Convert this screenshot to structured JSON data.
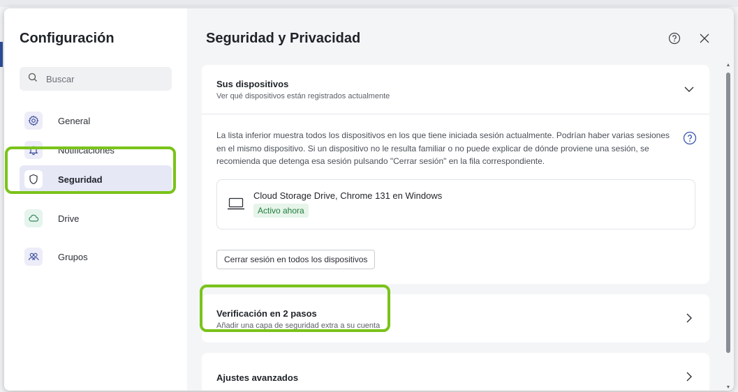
{
  "sidebar": {
    "title": "Configuración",
    "search_placeholder": "Buscar",
    "items": [
      {
        "label": "General",
        "icon": "gear-icon"
      },
      {
        "label": "Notificaciones",
        "icon": "bell-icon"
      },
      {
        "label": "Seguridad",
        "icon": "shield-icon",
        "active": true
      },
      {
        "label": "Drive",
        "icon": "cloud-icon"
      },
      {
        "label": "Grupos",
        "icon": "group-icon"
      }
    ]
  },
  "main": {
    "title": "Seguridad y Privacidad",
    "devices": {
      "title": "Sus dispositivos",
      "subtitle": "Ver qué dispositivos están registrados actualmente",
      "description": "La lista inferior muestra todos los dispositivos en los que tiene iniciada sesión actualmente. Podrían haber varias sesiones en el mismo dispositivo. Si un dispositivo no le resulta familiar o no puede explicar de dónde proviene una sesión, se recomienda que detenga esa sesión pulsando \"Cerrar sesión\" en la fila correspondiente.",
      "device_name": "Cloud Storage Drive, Chrome 131 en Windows",
      "device_status": "Activo ahora",
      "logout_all_label": "Cerrar sesión en todos los dispositivos"
    },
    "two_step": {
      "title": "Verificación en 2 pasos",
      "subtitle": "Añadir una capa de seguridad extra a su cuenta"
    },
    "advanced": {
      "title": "Ajustes avanzados"
    }
  },
  "colors": {
    "highlight": "#7ac31a",
    "active_bg": "#e6e8f6",
    "badge_bg": "#e6f4ea",
    "badge_text": "#1e7d3c"
  }
}
